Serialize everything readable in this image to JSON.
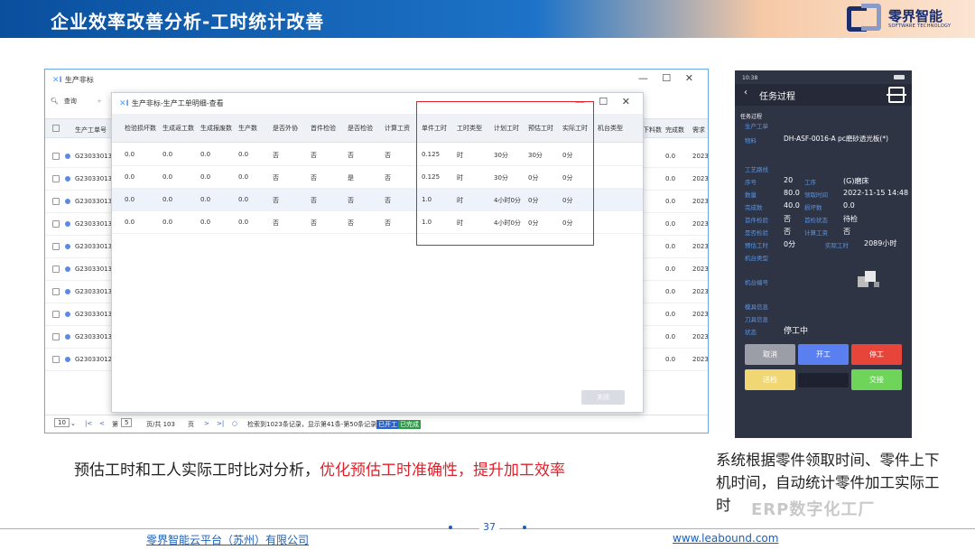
{
  "slide": {
    "title": "企业效率改善分析-工时统计改善",
    "brand": "零界智能",
    "brand_sub": "SOFTWARE TECHNOLOGY",
    "caption_prefix": "预估工时和工人实际工时比对分析，",
    "caption_highlight": "优化预估工时准确性，提升加工效率",
    "caption_right": "系统根据零件领取时间、零件上下机时间，自动统计零件加工实际工时",
    "watermark": "ERP数字化工厂",
    "page_number": "37",
    "footer_left": "零界智能云平台（苏州）有限公司",
    "footer_right": "www.leabound.com",
    "colors": {
      "accent": "#1b5fb4",
      "highlight": "#e0202a"
    }
  },
  "bgwin": {
    "title": "生产非标",
    "search": "查询",
    "add": "+",
    "header_code": "生产工单号",
    "header_extra1": "下料数",
    "header_extra2": "完成数",
    "header_extra3": "需求",
    "rows": [
      {
        "code": "G230330138",
        "done": "0.0",
        "year": "2023"
      },
      {
        "code": "G230330137",
        "done": "0.0",
        "year": "2023"
      },
      {
        "code": "G230330136",
        "done": "0.0",
        "year": "2023"
      },
      {
        "code": "G230330135",
        "done": "0.0",
        "year": "2023"
      },
      {
        "code": "G230330134",
        "done": "0.0",
        "year": "2023"
      },
      {
        "code": "G230330133",
        "done": "0.0",
        "year": "2023"
      },
      {
        "code": "G230330132",
        "done": "0.0",
        "year": "2023"
      },
      {
        "code": "G230330131",
        "done": "0.0",
        "year": "2023"
      },
      {
        "code": "G230330130",
        "done": "0.0",
        "year": "2023"
      },
      {
        "code": "G230330129",
        "done": "0.0",
        "year": "2023"
      }
    ],
    "pager": {
      "size": "10",
      "page_prefix": "第",
      "page": "5",
      "total": "页/共 103",
      "unit": "页",
      "info": "检索到1023条记录，显示第41条-第50条记录",
      "status1": "已开工",
      "status2": "已完成"
    }
  },
  "modal": {
    "title": "生产非标-生产工单明细-查看",
    "headers": [
      "检验损坏数",
      "生成返工数",
      "生成报废数",
      "生产数",
      "是否外协",
      "首件检验",
      "是否检验",
      "计算工资",
      "单件工时",
      "工时类型",
      "计划工时",
      "预估工时",
      "实际工时",
      "机台类型"
    ],
    "rows": [
      [
        "0.0",
        "0.0",
        "0.0",
        "0.0",
        "否",
        "否",
        "否",
        "否",
        "0.125",
        "时",
        "30分",
        "30分",
        "0分",
        ""
      ],
      [
        "0.0",
        "0.0",
        "0.0",
        "0.0",
        "否",
        "否",
        "是",
        "否",
        "0.125",
        "时",
        "30分",
        "0分",
        "0分",
        ""
      ],
      [
        "0.0",
        "0.0",
        "0.0",
        "0.0",
        "否",
        "否",
        "否",
        "否",
        "1.0",
        "时",
        "4小时0分",
        "0分",
        "0分",
        ""
      ],
      [
        "0.0",
        "0.0",
        "0.0",
        "0.0",
        "否",
        "否",
        "否",
        "否",
        "1.0",
        "时",
        "4小时0分",
        "0分",
        "0分",
        ""
      ]
    ],
    "close_label": "关闭"
  },
  "phone": {
    "status": "10:38",
    "title": "任务过程",
    "section_title": "任务过程",
    "work_order_label": "生产工单",
    "material_label": "物料",
    "material_value": "DH-ASF-0016-A pc磨砂透光板(*)",
    "route_label": "工艺路线",
    "seq_label": "序号",
    "seq_value": "20",
    "proc_label": "工序",
    "proc_value": "(G)磨床",
    "qty_label": "数量",
    "qty_value": "80.0",
    "pick_label": "领取时间",
    "pick_value": "2022-11-15 14:48",
    "fin_label": "完成数",
    "fin_value": "40.0",
    "dmg_label": "损坏数",
    "dmg_value": "0.0",
    "first_label": "首件检验",
    "first_value": "否",
    "firststat_label": "首检状态",
    "firststat_value": "待检",
    "insp_label": "是否检验",
    "insp_value": "否",
    "wage_label": "计算工资",
    "wage_value": "否",
    "est_label": "预估工时",
    "est_value": "0分",
    "act_label": "实际工时",
    "act_value": "2089小时",
    "machtype_label": "机台类型",
    "machno_label": "机台编号",
    "mold_label": "模具信息",
    "tool_label": "刀具信息",
    "state_label": "状态",
    "state_value": "停工中",
    "btn_cancel": "取消",
    "btn_start": "开工",
    "btn_stop": "停工",
    "btn_pick": "送检",
    "btn_handover": "交接"
  }
}
